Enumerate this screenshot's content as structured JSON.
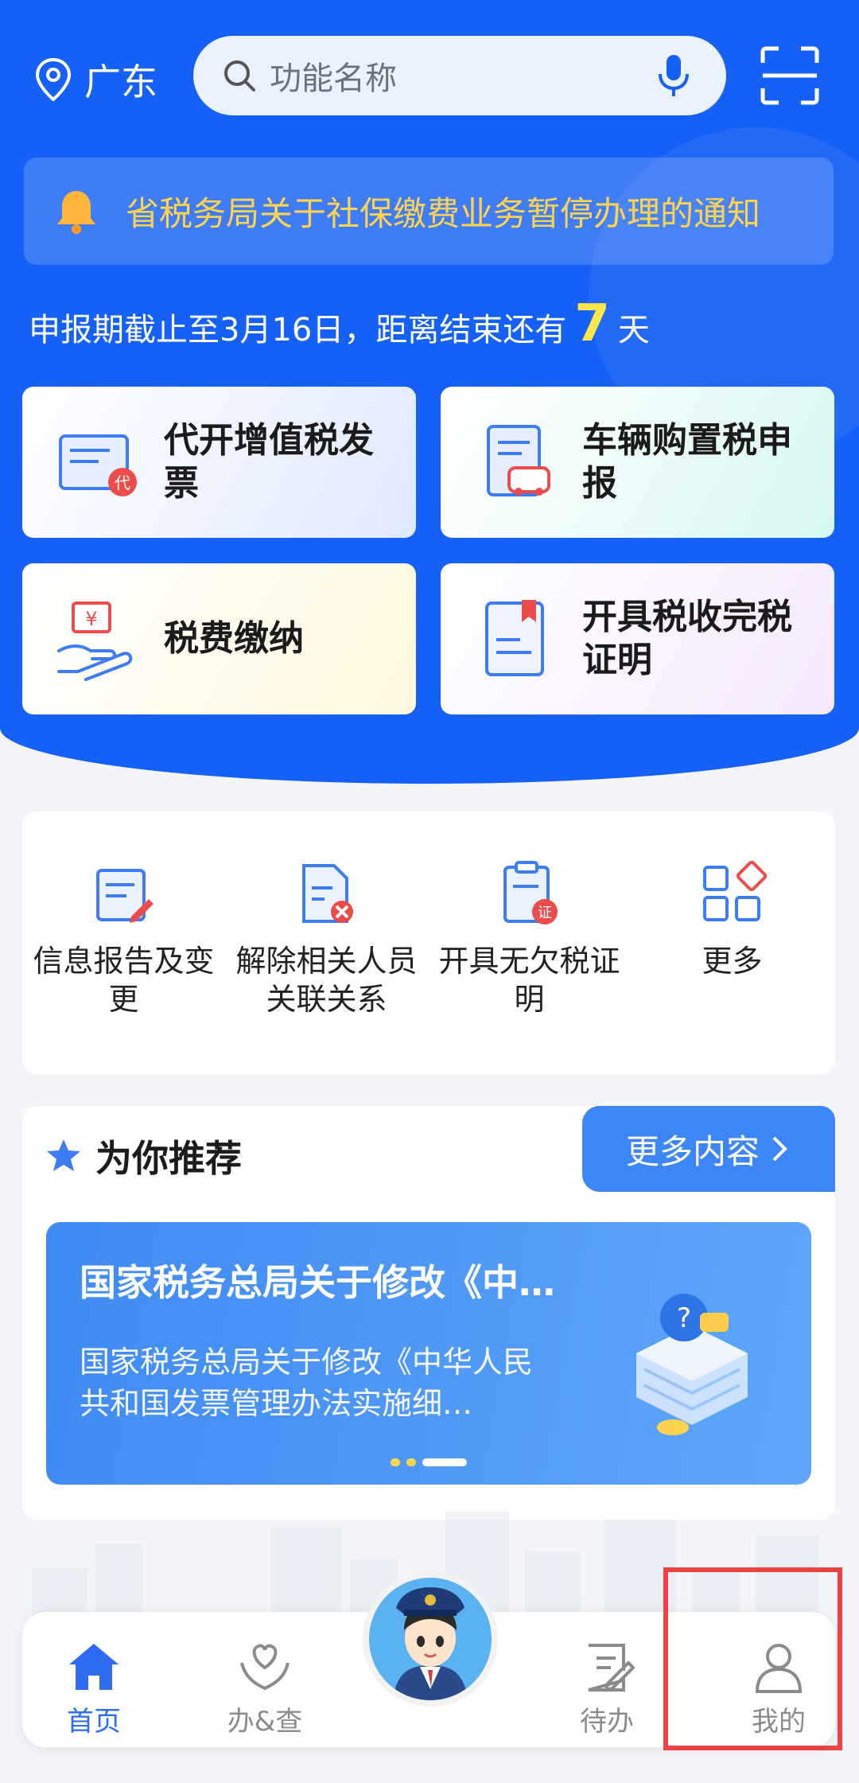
{
  "location": {
    "city": "广东",
    "icon": "location-pin-icon"
  },
  "search": {
    "placeholder": "功能名称",
    "search_icon": "search-icon",
    "mic_icon": "microphone-icon"
  },
  "scan_icon": "scan-icon",
  "notice": {
    "text": "省税务局关于社保缴费业务暂停办理的通知",
    "icon": "bell-icon",
    "color": "#ffd34d"
  },
  "deadline": {
    "prefix": "申报期截止至3月16日，距离结束还有",
    "days": "7",
    "suffix": "天"
  },
  "quick_cards": [
    {
      "label": "代开增值税发票",
      "icon": "invoice-icon"
    },
    {
      "label": "车辆购置税申报",
      "icon": "vehicle-tax-icon"
    },
    {
      "label": "税费缴纳",
      "icon": "payment-icon"
    },
    {
      "label": "开具税收完税证明",
      "icon": "tax-certificate-icon"
    }
  ],
  "services": [
    {
      "label": "信息报告及变更",
      "icon": "info-report-icon"
    },
    {
      "label": "解除相关人员关联关系",
      "icon": "unlink-document-icon"
    },
    {
      "label": "开具无欠税证明",
      "icon": "no-arrears-cert-icon"
    },
    {
      "label": "更多",
      "icon": "more-grid-icon"
    }
  ],
  "recommend": {
    "title": "为你推荐",
    "more_label": "更多内容",
    "banner": {
      "title": "国家税务总局关于修改《中…",
      "desc": "国家税务总局关于修改《中华人民共和国发票管理办法实施细…"
    }
  },
  "tabs": [
    {
      "label": "首页",
      "icon": "home-icon",
      "active": true
    },
    {
      "label": "办&查",
      "icon": "heart-hands-icon",
      "active": false
    },
    {
      "label": "待办",
      "icon": "todo-icon",
      "active": false
    },
    {
      "label": "我的",
      "icon": "user-icon",
      "active": false
    }
  ],
  "colors": {
    "brand_blue": "#1560f6",
    "active_tab": "#2d6cf0",
    "highlight": "#ef4343"
  }
}
